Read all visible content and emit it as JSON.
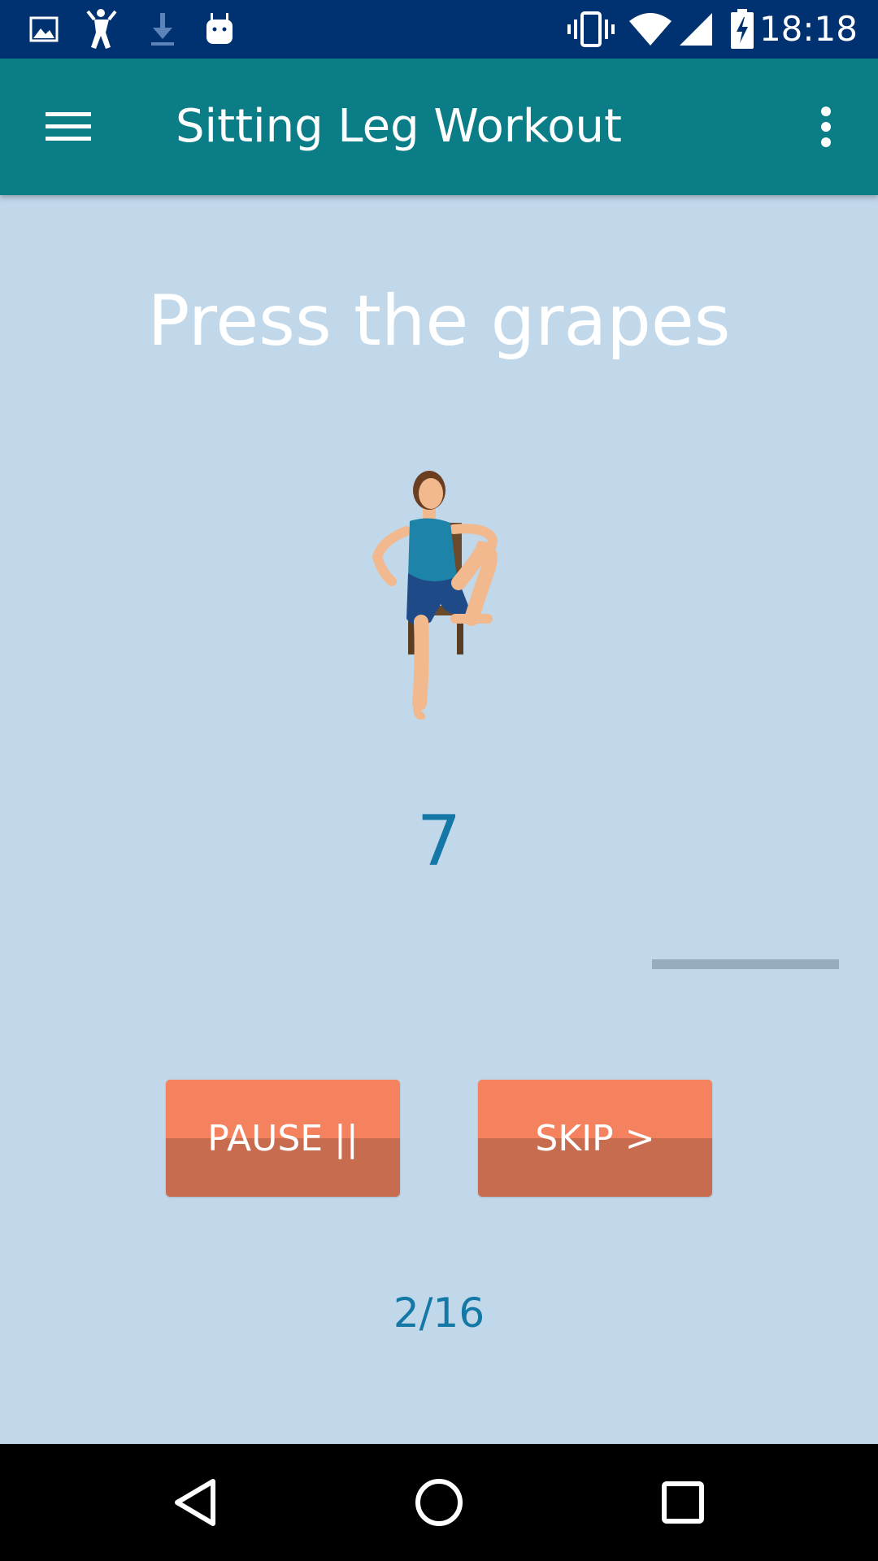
{
  "status_bar": {
    "time": "18:18",
    "left_icons": [
      "image-icon",
      "figure-icon",
      "download-icon",
      "android-icon"
    ],
    "right_icons": [
      "vibrate-icon",
      "wifi-icon",
      "signal-icon",
      "battery-charging-icon"
    ]
  },
  "app_bar": {
    "title": "Sitting Leg Workout",
    "menu_icon": "hamburger-menu-icon",
    "overflow_icon": "more-vert-icon",
    "color": "#0b7d86"
  },
  "exercise": {
    "name": "Press the grapes",
    "rep_count": "7",
    "progress_label": "2/16",
    "illustration_icon": "seated-exercise-figure-icon"
  },
  "controls": {
    "pause_label": "PAUSE ||",
    "skip_label": "SKIP >"
  },
  "nav_bar": {
    "icons": [
      "back-icon",
      "home-icon",
      "recents-icon"
    ]
  },
  "colors": {
    "background": "#c1d7ea",
    "status_bar": "#003170",
    "button": "#f5825e",
    "accent_text": "#1478a6"
  }
}
